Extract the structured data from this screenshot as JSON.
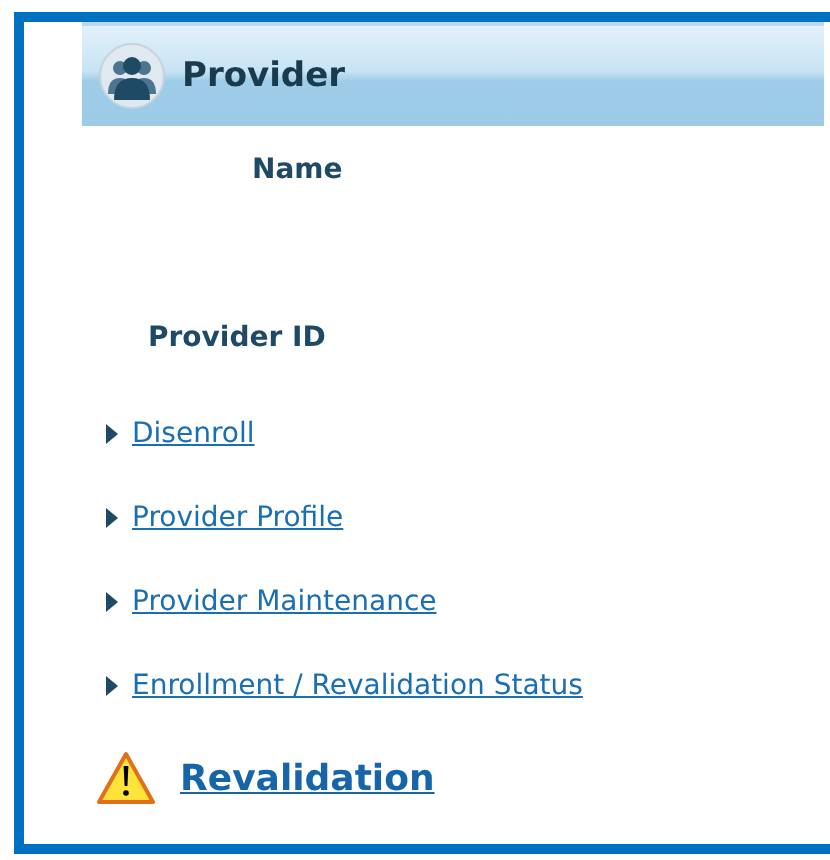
{
  "panel": {
    "title": "Provider"
  },
  "fields": [
    {
      "label": "Name"
    },
    {
      "label": "Provider ID"
    }
  ],
  "links": [
    "Disenroll",
    "Provider Profile",
    "Provider Maintenance",
    "Enrollment / Revalidation Status"
  ],
  "alert": {
    "label": "Revalidation"
  }
}
